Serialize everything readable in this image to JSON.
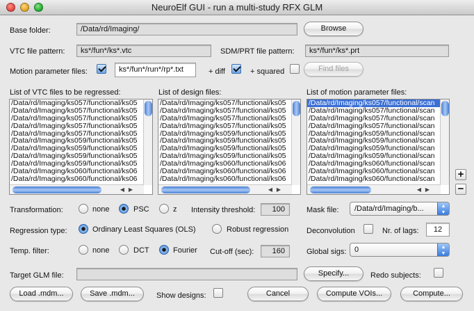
{
  "window": {
    "title": "NeuroElf GUI - run a multi-study RFX GLM"
  },
  "base_folder": {
    "label": "Base folder:",
    "value": "/Data/rd/Imaging/",
    "browse_label": "Browse"
  },
  "vtc_pattern": {
    "label": "VTC file pattern:",
    "value": "ks*/fun*/ks*.vtc"
  },
  "sdm_pattern": {
    "label": "SDM/PRT file pattern:",
    "value": "ks*/fun*/ks*.prt"
  },
  "motion": {
    "label": "Motion parameter files:",
    "value": "ks*/fun*/run*/rp*.txt",
    "diff_label": "+ diff",
    "squared_label": "+ squared",
    "find_label": "Find files"
  },
  "lists": {
    "vtc_header": "List of VTC files to be regressed:",
    "design_header": "List of design files:",
    "motion_header": "List of motion parameter files:",
    "vtc_rows": [
      "/Data/rd/Imaging/ks057/functional/ks05",
      "/Data/rd/Imaging/ks057/functional/ks05",
      "/Data/rd/Imaging/ks057/functional/ks05",
      "/Data/rd/Imaging/ks057/functional/ks05",
      "/Data/rd/Imaging/ks057/functional/ks05",
      "/Data/rd/Imaging/ks059/functional/ks05",
      "/Data/rd/Imaging/ks059/functional/ks05",
      "/Data/rd/Imaging/ks059/functional/ks05",
      "/Data/rd/Imaging/ks059/functional/ks05",
      "/Data/rd/Imaging/ks060/functional/ks06",
      "/Data/rd/Imaging/ks060/functional/ks06"
    ],
    "design_rows": [
      "/Data/rd/Imaging/ks057/functional/ks05",
      "/Data/rd/Imaging/ks057/functional/ks05",
      "/Data/rd/Imaging/ks057/functional/ks05",
      "/Data/rd/Imaging/ks057/functional/ks05",
      "/Data/rd/Imaging/ks059/functional/ks05",
      "/Data/rd/Imaging/ks059/functional/ks05",
      "/Data/rd/Imaging/ks059/functional/ks05",
      "/Data/rd/Imaging/ks059/functional/ks05",
      "/Data/rd/Imaging/ks060/functional/ks06",
      "/Data/rd/Imaging/ks060/functional/ks06",
      "/Data/rd/Imaging/ks060/functional/ks06"
    ],
    "motion_rows": [
      "/Data/rd/Imaging/ks057/functional/scan",
      "/Data/rd/Imaging/ks057/functional/scan",
      "/Data/rd/Imaging/ks057/functional/scan",
      "/Data/rd/Imaging/ks057/functional/scan",
      "/Data/rd/Imaging/ks059/functional/scan",
      "/Data/rd/Imaging/ks059/functional/scan",
      "/Data/rd/Imaging/ks059/functional/scan",
      "/Data/rd/Imaging/ks059/functional/scan",
      "/Data/rd/Imaging/ks060/functional/scan",
      "/Data/rd/Imaging/ks060/functional/scan",
      "/Data/rd/Imaging/ks060/functional/scan"
    ],
    "plus_label": "+",
    "minus_label": "−"
  },
  "transformation": {
    "label": "Transformation:",
    "none": "none",
    "psc": "PSC",
    "z": "z",
    "selected": "PSC"
  },
  "intensity": {
    "label": "Intensity threshold:",
    "value": "100"
  },
  "mask": {
    "label": "Mask file:",
    "value": "/Data/rd/Imaging/b..."
  },
  "regression": {
    "label": "Regression type:",
    "ols": "Ordinary Least Squares (OLS)",
    "robust": "Robust regression",
    "selected": "OLS"
  },
  "deconvolution": {
    "label": "Deconvolution",
    "lags_label": "Nr. of lags:",
    "lags_value": "12"
  },
  "temp_filter": {
    "label": "Temp. filter:",
    "none": "none",
    "dct": "DCT",
    "fourier": "Fourier",
    "selected": "Fourier",
    "cutoff_label": "Cut-off (sec):",
    "cutoff_value": "160"
  },
  "global_sigs": {
    "label": "Global sigs:",
    "value": "0"
  },
  "target_glm": {
    "label": "Target GLM file:",
    "value": "",
    "specify_label": "Specify...",
    "redo_label": "Redo subjects:"
  },
  "footer": {
    "load_label": "Load .mdm...",
    "save_label": "Save .mdm...",
    "show_designs_label": "Show designs:",
    "cancel_label": "Cancel",
    "vois_label": "Compute VOIs...",
    "compute_label": "Compute..."
  },
  "colors": {
    "selection": "#3b6fd4",
    "scroll_thumb": "#4a7fd6",
    "close": "#e0443e",
    "minimize": "#dea123",
    "zoom": "#1aab29"
  }
}
